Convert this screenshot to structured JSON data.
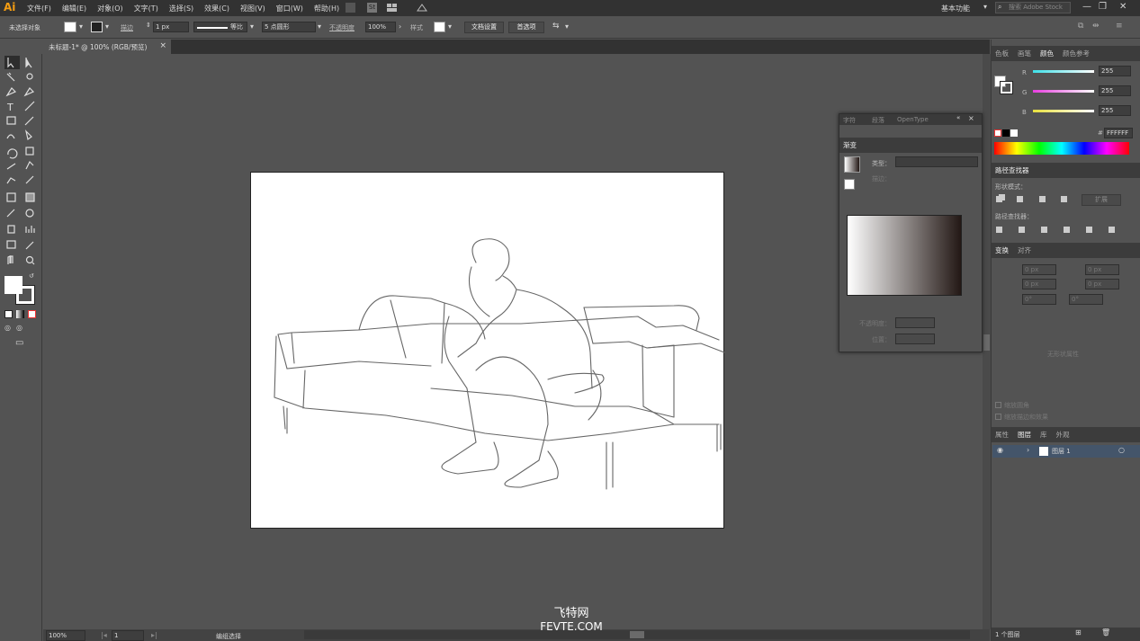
{
  "menubar": {
    "logo": "Ai",
    "items": [
      "文件(F)",
      "编辑(E)",
      "对象(O)",
      "文字(T)",
      "选择(S)",
      "效果(C)",
      "视图(V)",
      "窗口(W)",
      "帮助(H)"
    ],
    "workspace": "基本功能",
    "search_placeholder": "搜索 Adobe Stock",
    "window_buttons": [
      "—",
      "❐",
      "✕"
    ]
  },
  "control": {
    "no_selection": "未选择对象",
    "stroke_label": "描边",
    "stroke_value": "1 px",
    "stroke_style": "等比",
    "brush": "5 点圆形",
    "opacity_label": "不透明度",
    "opacity_value": "100%",
    "style_label": "样式",
    "doc_setup": "文档设置",
    "prefs": "首选项"
  },
  "document": {
    "tab_title": "未标题-1* @ 100% (RGB/预览)",
    "close": "×"
  },
  "status": {
    "zoom": "100%",
    "artboard": "1",
    "tool": "编组选择"
  },
  "color_panel": {
    "tabs": [
      "色板",
      "画笔",
      "颜色",
      "颜色参考"
    ],
    "active_tab": "颜色",
    "channels": [
      {
        "name": "R",
        "value": "255",
        "color": "#3ee0e8"
      },
      {
        "name": "G",
        "value": "255",
        "color": "#e83ee0"
      },
      {
        "name": "B",
        "value": "255",
        "color": "#e8e03e"
      }
    ],
    "hex_label": "#",
    "hex_value": "FFFFFF"
  },
  "pathfinder": {
    "title": "路径查找器",
    "shape_modes": "形状模式：",
    "expand": "扩展",
    "pathfinders": "路径查找器："
  },
  "transform": {
    "tabs": [
      "变换",
      "对齐"
    ],
    "x": "0 px",
    "y": "0 px",
    "w": "0 px",
    "h": "0 px",
    "angle": "0°",
    "shear": "0°",
    "no_state": "无形状属性",
    "scale_corners": "缩放圆角",
    "scale_strokes": "缩放描边和效果"
  },
  "layers_panel": {
    "tabs": [
      "属性",
      "图层",
      "库",
      "外观"
    ],
    "active_tab": "图层",
    "layer_name": "图层 1",
    "count": "1 个图层"
  },
  "gradient_panel": {
    "bg_tabs": [
      "字符",
      "段落",
      "OpenType"
    ],
    "title": "渐变",
    "type_label": "类型：",
    "stroke_label": "描边：",
    "opacity_label": "不透明度：",
    "position_label": "位置："
  },
  "watermark": {
    "line1": "飞特网",
    "line2": "FEVTE.COM"
  }
}
